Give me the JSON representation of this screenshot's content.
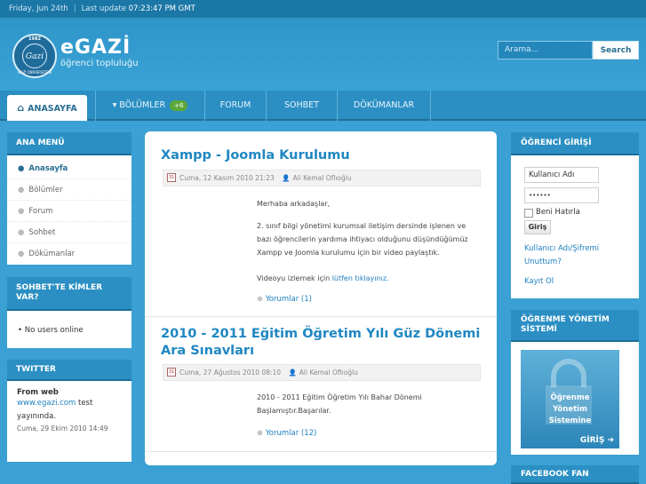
{
  "topbar": {
    "date": "Friday, Jun 24th",
    "separator": "|",
    "update_label": "Last update",
    "update_time": "07:23:47 PM GMT"
  },
  "logo": {
    "year": "1982",
    "monogram": "Gazi",
    "university": "GAZİ ÜNİVERSİTESİ",
    "name": "eGAZİ",
    "tagline": "öğrenci topluluğu"
  },
  "search": {
    "placeholder": "Arama...",
    "button": "Search"
  },
  "nav": {
    "items": [
      {
        "label": "ANASAYFA",
        "icon": "home-icon"
      },
      {
        "label": "BÖLÜMLER",
        "icon": "caret-down-icon",
        "badge": "+6"
      },
      {
        "label": "FORUM"
      },
      {
        "label": "SOHBET"
      },
      {
        "label": "DÖKÜMANLAR"
      }
    ]
  },
  "left": {
    "menu_title": "ANA MENÜ",
    "menu": [
      {
        "label": "Anasayfa"
      },
      {
        "label": "Bölümler"
      },
      {
        "label": "Forum"
      },
      {
        "label": "Sohbet"
      },
      {
        "label": "Dökümanlar"
      }
    ],
    "chat_title": "SOHBET'TE KİMLER VAR?",
    "chat_status": "No users online",
    "twitter_title": "TWITTER",
    "twitter": {
      "from": "From web",
      "link": "www.egazi.com",
      "text_after_link": " test",
      "text_line2": "yayınında.",
      "date": "Cuma, 29 Ekim 2010 14:49"
    }
  },
  "posts": [
    {
      "title": "Xampp - Joomla Kurulumu",
      "date": "Cuma, 12 Kasım 2010 21:23",
      "author": "Ali Kemal Oflıoğlu",
      "paragraphs": [
        "Merhaba arkadaşlar,",
        "2. sınıf bilgi yönetimi kurumsal iletişim dersinde işlenen ve bazı öğrencilerin yardıma ihtiyacı olduğunu düşündüğümüz Xampp ve Joomla kurulumu için bir video paylaştık."
      ],
      "video_text": "Videoyu izlemek için ",
      "video_link": "lütfen tıklayınız.",
      "comments": "Yorumlar (1)"
    },
    {
      "title": "2010 - 2011 Eğitim Öğretim Yılı Güz Dönemi Ara Sınavları",
      "date": "Cuma, 27 Ağustos 2010 08:10",
      "author": "Ali Kemal Oflıoğlu",
      "paragraphs": [
        "2010 - 2011 Eğitim Öğretim Yılı Bahar Dönemi Başlamıştır.Başarılar."
      ],
      "comments": "Yorumlar (12)"
    }
  ],
  "right": {
    "login_title": "ÖĞRENCİ GİRİŞİ",
    "username_placeholder": "Kullanıcı Adı",
    "password_value": "••••••",
    "remember": "Beni Hatırla",
    "login_button": "Giriş",
    "forgot": "Kullanıcı Adı/Şifremi Unuttum?",
    "register": "Kayıt Ol",
    "lms_title": "ÖĞRENME YÖNETİM SİSTEMİ",
    "lms_lines": [
      "Öğrenme",
      "Yönetim",
      "Sistemine"
    ],
    "lms_go": "GİRİŞ ➔",
    "facebook_title": "FACEBOOK FAN"
  }
}
